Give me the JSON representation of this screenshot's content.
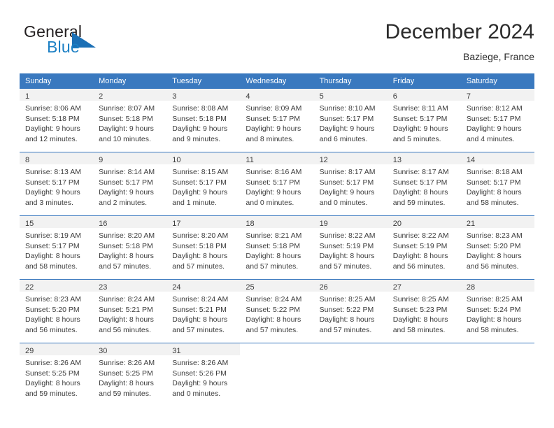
{
  "brand": {
    "name_top": "General",
    "name_bottom": "Blue",
    "mark": "triangle-logo",
    "color_text": "#231f20",
    "color_blue": "#1b7fc4"
  },
  "header": {
    "title": "December 2024",
    "subtitle": "Baziege, France"
  },
  "theme": {
    "header_bg": "#3a79bf",
    "header_text": "#ffffff",
    "daynum_band": "#f2f2f2",
    "grid_line": "#3a79bf",
    "body_text": "#3c3c3c"
  },
  "weekdays": [
    "Sunday",
    "Monday",
    "Tuesday",
    "Wednesday",
    "Thursday",
    "Friday",
    "Saturday"
  ],
  "weeks": [
    [
      {
        "day": "1",
        "sunrise": "Sunrise: 8:06 AM",
        "sunset": "Sunset: 5:18 PM",
        "daylight1": "Daylight: 9 hours",
        "daylight2": "and 12 minutes."
      },
      {
        "day": "2",
        "sunrise": "Sunrise: 8:07 AM",
        "sunset": "Sunset: 5:18 PM",
        "daylight1": "Daylight: 9 hours",
        "daylight2": "and 10 minutes."
      },
      {
        "day": "3",
        "sunrise": "Sunrise: 8:08 AM",
        "sunset": "Sunset: 5:18 PM",
        "daylight1": "Daylight: 9 hours",
        "daylight2": "and 9 minutes."
      },
      {
        "day": "4",
        "sunrise": "Sunrise: 8:09 AM",
        "sunset": "Sunset: 5:17 PM",
        "daylight1": "Daylight: 9 hours",
        "daylight2": "and 8 minutes."
      },
      {
        "day": "5",
        "sunrise": "Sunrise: 8:10 AM",
        "sunset": "Sunset: 5:17 PM",
        "daylight1": "Daylight: 9 hours",
        "daylight2": "and 6 minutes."
      },
      {
        "day": "6",
        "sunrise": "Sunrise: 8:11 AM",
        "sunset": "Sunset: 5:17 PM",
        "daylight1": "Daylight: 9 hours",
        "daylight2": "and 5 minutes."
      },
      {
        "day": "7",
        "sunrise": "Sunrise: 8:12 AM",
        "sunset": "Sunset: 5:17 PM",
        "daylight1": "Daylight: 9 hours",
        "daylight2": "and 4 minutes."
      }
    ],
    [
      {
        "day": "8",
        "sunrise": "Sunrise: 8:13 AM",
        "sunset": "Sunset: 5:17 PM",
        "daylight1": "Daylight: 9 hours",
        "daylight2": "and 3 minutes."
      },
      {
        "day": "9",
        "sunrise": "Sunrise: 8:14 AM",
        "sunset": "Sunset: 5:17 PM",
        "daylight1": "Daylight: 9 hours",
        "daylight2": "and 2 minutes."
      },
      {
        "day": "10",
        "sunrise": "Sunrise: 8:15 AM",
        "sunset": "Sunset: 5:17 PM",
        "daylight1": "Daylight: 9 hours",
        "daylight2": "and 1 minute."
      },
      {
        "day": "11",
        "sunrise": "Sunrise: 8:16 AM",
        "sunset": "Sunset: 5:17 PM",
        "daylight1": "Daylight: 9 hours",
        "daylight2": "and 0 minutes."
      },
      {
        "day": "12",
        "sunrise": "Sunrise: 8:17 AM",
        "sunset": "Sunset: 5:17 PM",
        "daylight1": "Daylight: 9 hours",
        "daylight2": "and 0 minutes."
      },
      {
        "day": "13",
        "sunrise": "Sunrise: 8:17 AM",
        "sunset": "Sunset: 5:17 PM",
        "daylight1": "Daylight: 8 hours",
        "daylight2": "and 59 minutes."
      },
      {
        "day": "14",
        "sunrise": "Sunrise: 8:18 AM",
        "sunset": "Sunset: 5:17 PM",
        "daylight1": "Daylight: 8 hours",
        "daylight2": "and 58 minutes."
      }
    ],
    [
      {
        "day": "15",
        "sunrise": "Sunrise: 8:19 AM",
        "sunset": "Sunset: 5:17 PM",
        "daylight1": "Daylight: 8 hours",
        "daylight2": "and 58 minutes."
      },
      {
        "day": "16",
        "sunrise": "Sunrise: 8:20 AM",
        "sunset": "Sunset: 5:18 PM",
        "daylight1": "Daylight: 8 hours",
        "daylight2": "and 57 minutes."
      },
      {
        "day": "17",
        "sunrise": "Sunrise: 8:20 AM",
        "sunset": "Sunset: 5:18 PM",
        "daylight1": "Daylight: 8 hours",
        "daylight2": "and 57 minutes."
      },
      {
        "day": "18",
        "sunrise": "Sunrise: 8:21 AM",
        "sunset": "Sunset: 5:18 PM",
        "daylight1": "Daylight: 8 hours",
        "daylight2": "and 57 minutes."
      },
      {
        "day": "19",
        "sunrise": "Sunrise: 8:22 AM",
        "sunset": "Sunset: 5:19 PM",
        "daylight1": "Daylight: 8 hours",
        "daylight2": "and 57 minutes."
      },
      {
        "day": "20",
        "sunrise": "Sunrise: 8:22 AM",
        "sunset": "Sunset: 5:19 PM",
        "daylight1": "Daylight: 8 hours",
        "daylight2": "and 56 minutes."
      },
      {
        "day": "21",
        "sunrise": "Sunrise: 8:23 AM",
        "sunset": "Sunset: 5:20 PM",
        "daylight1": "Daylight: 8 hours",
        "daylight2": "and 56 minutes."
      }
    ],
    [
      {
        "day": "22",
        "sunrise": "Sunrise: 8:23 AM",
        "sunset": "Sunset: 5:20 PM",
        "daylight1": "Daylight: 8 hours",
        "daylight2": "and 56 minutes."
      },
      {
        "day": "23",
        "sunrise": "Sunrise: 8:24 AM",
        "sunset": "Sunset: 5:21 PM",
        "daylight1": "Daylight: 8 hours",
        "daylight2": "and 56 minutes."
      },
      {
        "day": "24",
        "sunrise": "Sunrise: 8:24 AM",
        "sunset": "Sunset: 5:21 PM",
        "daylight1": "Daylight: 8 hours",
        "daylight2": "and 57 minutes."
      },
      {
        "day": "25",
        "sunrise": "Sunrise: 8:24 AM",
        "sunset": "Sunset: 5:22 PM",
        "daylight1": "Daylight: 8 hours",
        "daylight2": "and 57 minutes."
      },
      {
        "day": "26",
        "sunrise": "Sunrise: 8:25 AM",
        "sunset": "Sunset: 5:22 PM",
        "daylight1": "Daylight: 8 hours",
        "daylight2": "and 57 minutes."
      },
      {
        "day": "27",
        "sunrise": "Sunrise: 8:25 AM",
        "sunset": "Sunset: 5:23 PM",
        "daylight1": "Daylight: 8 hours",
        "daylight2": "and 58 minutes."
      },
      {
        "day": "28",
        "sunrise": "Sunrise: 8:25 AM",
        "sunset": "Sunset: 5:24 PM",
        "daylight1": "Daylight: 8 hours",
        "daylight2": "and 58 minutes."
      }
    ],
    [
      {
        "day": "29",
        "sunrise": "Sunrise: 8:26 AM",
        "sunset": "Sunset: 5:25 PM",
        "daylight1": "Daylight: 8 hours",
        "daylight2": "and 59 minutes."
      },
      {
        "day": "30",
        "sunrise": "Sunrise: 8:26 AM",
        "sunset": "Sunset: 5:25 PM",
        "daylight1": "Daylight: 8 hours",
        "daylight2": "and 59 minutes."
      },
      {
        "day": "31",
        "sunrise": "Sunrise: 8:26 AM",
        "sunset": "Sunset: 5:26 PM",
        "daylight1": "Daylight: 9 hours",
        "daylight2": "and 0 minutes."
      },
      {
        "day": "",
        "sunrise": "",
        "sunset": "",
        "daylight1": "",
        "daylight2": ""
      },
      {
        "day": "",
        "sunrise": "",
        "sunset": "",
        "daylight1": "",
        "daylight2": ""
      },
      {
        "day": "",
        "sunrise": "",
        "sunset": "",
        "daylight1": "",
        "daylight2": ""
      },
      {
        "day": "",
        "sunrise": "",
        "sunset": "",
        "daylight1": "",
        "daylight2": ""
      }
    ]
  ]
}
